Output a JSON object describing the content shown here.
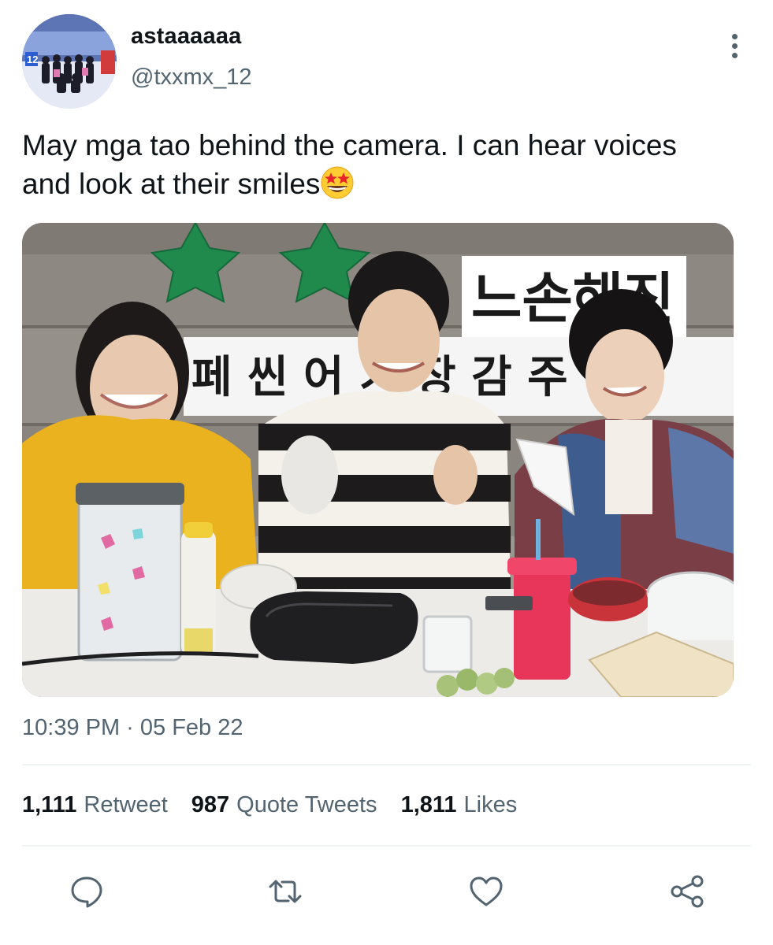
{
  "user": {
    "display_name": "astaaaaaa",
    "handle": "@txxmx_12",
    "avatar_icon": "group-photo-avatar"
  },
  "tweet": {
    "text": "May mga tao behind the camera. I can hear voices and look at their smiles",
    "emoji": "star-struck-emoji",
    "timestamp": "10:39 PM · 05 Feb 22"
  },
  "media": {
    "description_icon": "video-frame-image",
    "sign_top": "느손해진",
    "sign_banner": "페 씬 어 기 장 감 주 리"
  },
  "stats": {
    "retweets": {
      "count": "1,111",
      "label": "Retweet"
    },
    "quotes": {
      "count": "987",
      "label": "Quote Tweets"
    },
    "likes": {
      "count": "1,811",
      "label": "Likes"
    }
  },
  "actions": [
    "reply-icon",
    "retweet-icon",
    "like-icon",
    "share-icon"
  ],
  "colors": {
    "text_primary": "#0f1419",
    "text_secondary": "#536471",
    "divider": "#eff3f4"
  }
}
